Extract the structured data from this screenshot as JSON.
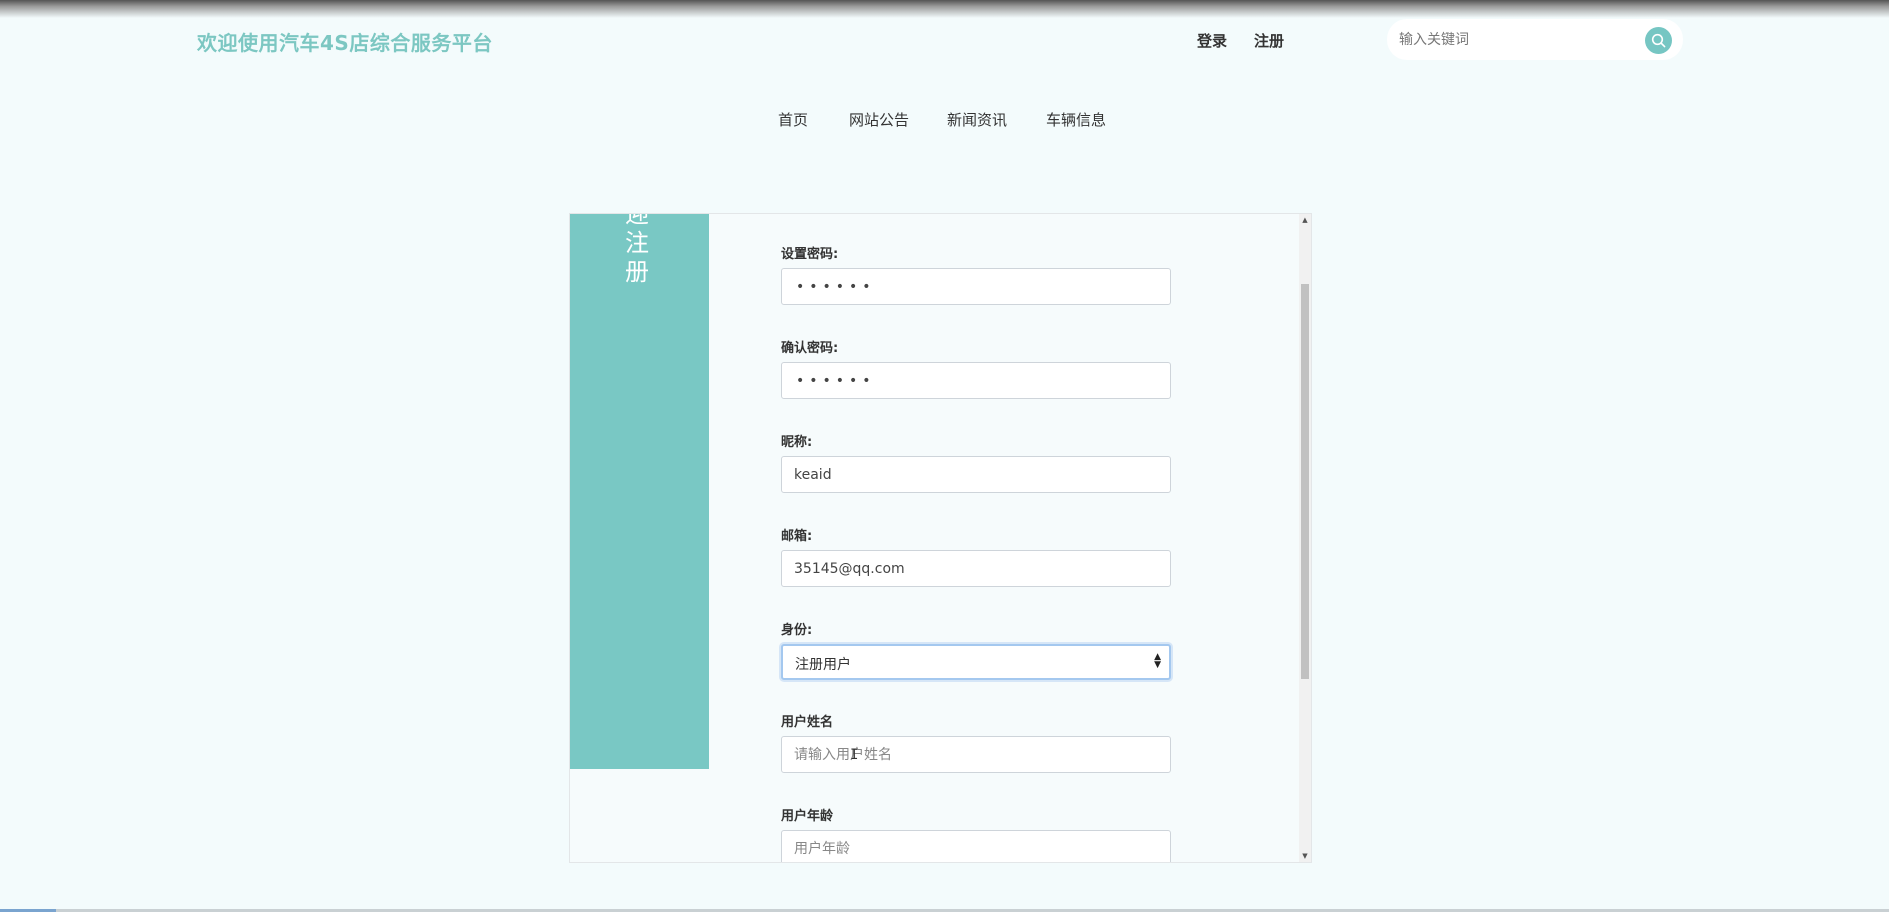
{
  "header": {
    "brand": "欢迎使用汽车4S店综合服务平台",
    "login": "登录",
    "register": "注册",
    "search_placeholder": "输入关键词"
  },
  "nav": {
    "items": [
      "首页",
      "网站公告",
      "新闻资讯",
      "车辆信息"
    ]
  },
  "form": {
    "side_title": "迎注册",
    "password_label": "设置密码:",
    "password_value": "••••••",
    "confirm_label": "确认密码:",
    "confirm_value": "••••••",
    "nickname_label": "昵称:",
    "nickname_value": "keaid",
    "email_label": "邮箱:",
    "email_value": "35145@qq.com",
    "identity_label": "身份:",
    "identity_value": "注册用户",
    "username_label": "用户姓名",
    "username_placeholder": "请输入用户姓名",
    "age_label": "用户年龄",
    "age_placeholder": "用户年龄"
  },
  "icons": {
    "search": "search-icon",
    "select_caret": "sort-caret-icon"
  },
  "colors": {
    "accent": "#79c8c4",
    "brand_text": "#7cc7c2"
  }
}
